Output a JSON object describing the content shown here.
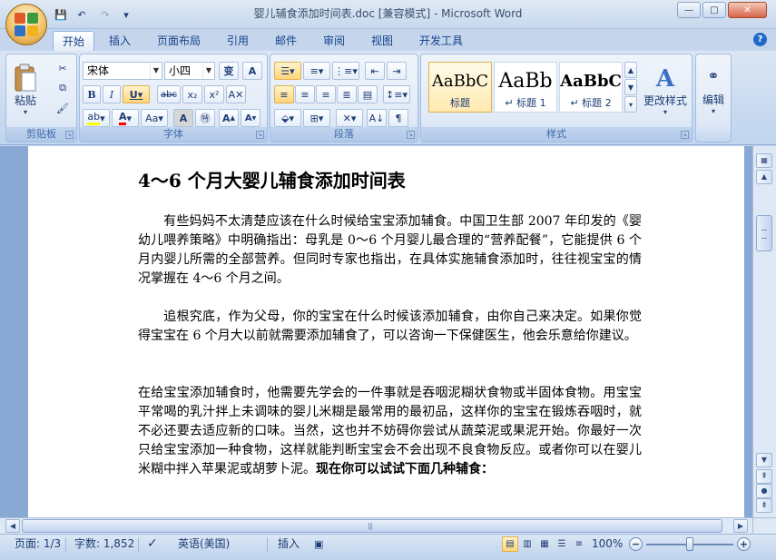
{
  "window": {
    "doc_name": "婴儿辅食添加时间表.doc",
    "mode": "[兼容模式]",
    "separator": "-",
    "app_name": "Microsoft Word"
  },
  "window_controls": {
    "minimize": "—",
    "maximize": "□",
    "close": "✕"
  },
  "qat": {
    "save": "💾",
    "undo": "↶",
    "redo": "↷",
    "customize": "▾"
  },
  "tabs": [
    {
      "label": "开始",
      "active": true
    },
    {
      "label": "插入"
    },
    {
      "label": "页面布局"
    },
    {
      "label": "引用"
    },
    {
      "label": "邮件"
    },
    {
      "label": "审阅"
    },
    {
      "label": "视图"
    },
    {
      "label": "开发工具"
    }
  ],
  "help": "?",
  "ribbon": {
    "clipboard": {
      "label": "剪贴板",
      "paste": "粘贴",
      "paste_arrow": "▾"
    },
    "font": {
      "label": "字体",
      "font_name": "宋体",
      "font_size": "小四",
      "wen": "变",
      "bold": "B",
      "italic": "I",
      "underline": "U",
      "strike": "abc",
      "subscript": "x₂",
      "superscript": "x²",
      "change_case": "Aa",
      "grow": "A",
      "shrink": "A",
      "highlight_color": "#ffff00",
      "font_color": "#ff0000"
    },
    "paragraph": {
      "label": "段落"
    },
    "styles": {
      "label": "样式",
      "items": [
        {
          "sample": "AaBbC",
          "name": "标题"
        },
        {
          "sample": "AaBb",
          "name": "↵ 标题 1"
        },
        {
          "sample": "AaBbC",
          "name": "↵ 标题 2"
        }
      ],
      "change": "更改样式"
    },
    "editing": {
      "label": "编辑"
    }
  },
  "document": {
    "heading": "4～6 个月大婴儿辅食添加时间表",
    "paragraphs": [
      "有些妈妈不太清楚应该在什么时候给宝宝添加辅食。中国卫生部 2007 年印发的《婴幼儿喂养策略》中明确指出：母乳是 0～6 个月婴儿最合理的“营养配餐”，它能提供 6 个月内婴儿所需的全部营养。但同时专家也指出，在具体实施辅食添加时，往往视宝宝的情况掌握在 4～6 个月之间。",
      "追根究底，作为父母，你的宝宝在什么时候该添加辅食，由你自己来决定。如果你觉得宝宝在 6 个月大以前就需要添加辅食了，可以咨询一下保健医生，他会乐意给你建议。",
      "在给宝宝添加辅食时，他需要先学会的一件事就是吞咽泥糊状食物或半固体食物。用宝宝平常喝的乳汁拌上未调味的婴儿米糊是最常用的最初品，这样你的宝宝在锻炼吞咽时，就不必还要去适应新的口味。当然，这也并不妨碍你尝试从蔬菜泥或果泥开始。你最好一次只给宝宝添加一种食物，这样就能判断宝宝会不会出现不良食物反应。或者你可以在婴儿米糊中拌入苹果泥或胡萝卜泥。"
    ],
    "bold_tail": "现在你可以试试下面几种辅食："
  },
  "statusbar": {
    "page": "页面: 1/3",
    "words": "字数: 1,852",
    "language": "英语(美国)",
    "insert_mode": "插入",
    "zoom": "100%",
    "zoom_level": 0.5
  }
}
